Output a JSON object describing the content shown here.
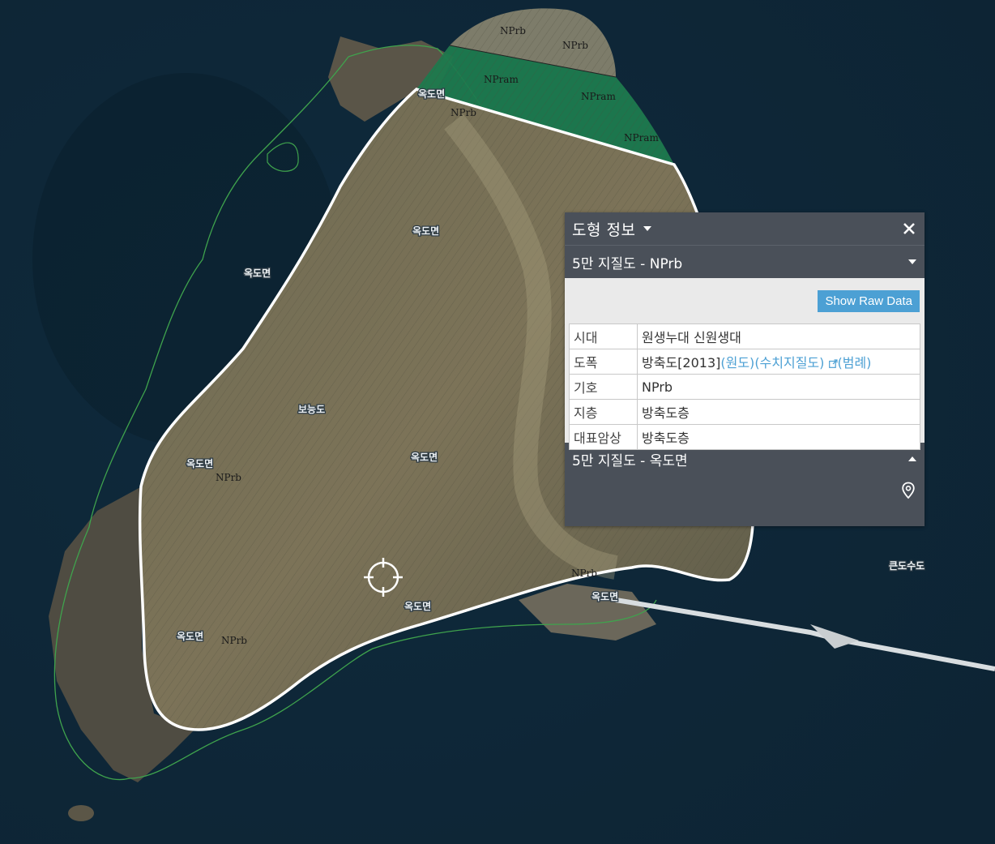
{
  "map": {
    "place_labels": [
      "옥도면",
      "옥도면",
      "옥도면",
      "옥도면",
      "옥도면",
      "옥도면",
      "옥도면",
      "옥도면"
    ],
    "island_name": "보능도",
    "other_island": "큰도수도",
    "geo_codes": [
      "NPrb",
      "NPrb",
      "NPram",
      "NPram",
      "NPram",
      "NPrb",
      "NPrb",
      "NPrb",
      "NPrb"
    ],
    "colors": {
      "sea": "#102a3c",
      "selected_outline": "#ffffff",
      "unit_nprb": "#8a8670",
      "unit_npram": "#2e8a5c",
      "coastline": "#3fa34d"
    }
  },
  "panel": {
    "title": "도형 정보",
    "close_icon": "close-icon",
    "section1": {
      "label": "5만 지질도 - NPrb",
      "raw_button": "Show Raw Data",
      "rows": [
        {
          "key": "시대",
          "value": "원생누대 신원생대"
        },
        {
          "key": "도폭",
          "value": "방축도[2013]",
          "links": [
            "(원도)",
            "(수치지질도)",
            "(범례)"
          ]
        },
        {
          "key": "기호",
          "value": "NPrb"
        },
        {
          "key": "지층",
          "value": "방축도층"
        },
        {
          "key": "대표암상",
          "value": "방축도층"
        }
      ]
    },
    "section2": {
      "label": "5만 지질도 - 옥도면"
    }
  }
}
